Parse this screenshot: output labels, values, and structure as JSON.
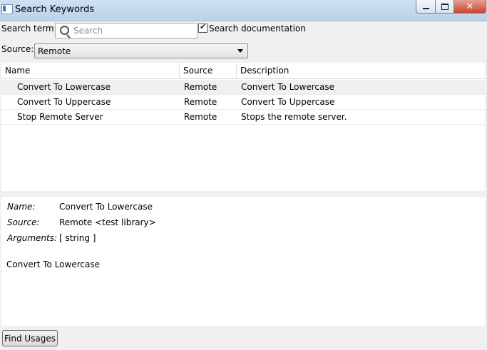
{
  "window": {
    "title": "Search Keywords",
    "minimize": "–",
    "maximize": "□",
    "close": "✕"
  },
  "search": {
    "label": "Search term:",
    "placeholder": "Search",
    "value": "",
    "doc_checkbox_label": "Search documentation",
    "doc_checked": true
  },
  "source": {
    "label": "Source:",
    "selected": "Remote"
  },
  "table": {
    "columns": [
      "Name",
      "Source",
      "Description"
    ],
    "rows": [
      {
        "name": "Convert To Lowercase",
        "source": "Remote",
        "description": "Convert To Lowercase"
      },
      {
        "name": "Convert To Uppercase",
        "source": "Remote",
        "description": "Convert To Uppercase"
      },
      {
        "name": "Stop Remote Server",
        "source": "Remote",
        "description": "Stops the remote server."
      }
    ]
  },
  "details": {
    "name_label": "Name:",
    "name_value": "Convert To Lowercase",
    "source_label": "Source:",
    "source_value": "Remote <test library>",
    "args_label": "Arguments:",
    "args_value": "[ string ]",
    "documentation": "Convert To Lowercase"
  },
  "buttons": {
    "find_usages": "Find Usages"
  }
}
